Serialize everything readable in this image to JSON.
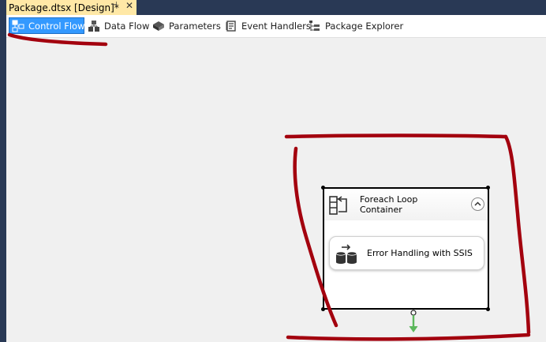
{
  "document_tab": {
    "title": "Package.dtsx [Design]*",
    "pin_glyph": "⊣",
    "close_glyph": "✕"
  },
  "designer_tabs": [
    {
      "label": "Control Flow",
      "icon": "control-flow-icon",
      "active": true
    },
    {
      "label": "Data Flow",
      "icon": "data-flow-icon",
      "active": false
    },
    {
      "label": "Parameters",
      "icon": "parameters-icon",
      "active": false
    },
    {
      "label": "Event Handlers",
      "icon": "event-handlers-icon",
      "active": false
    },
    {
      "label": "Package Explorer",
      "icon": "package-explorer-icon",
      "active": false
    }
  ],
  "canvas": {
    "container": {
      "title_line1": "Foreach Loop",
      "title_line2": "Container",
      "icon": "foreach-loop-icon",
      "collapse_icon": "chevron-up-icon",
      "task": {
        "label": "Error Handling with SSIS",
        "icon": "execute-sql-task-icon"
      }
    },
    "precedence_constraint_color": "#5cb85c"
  },
  "annotation_color": "#a3000e",
  "colors": {
    "chrome": "#293955",
    "active_doc_tab": "#ffe8a6",
    "active_designer_tab": "#3399ff",
    "canvas_bg": "#f0f0f0"
  }
}
